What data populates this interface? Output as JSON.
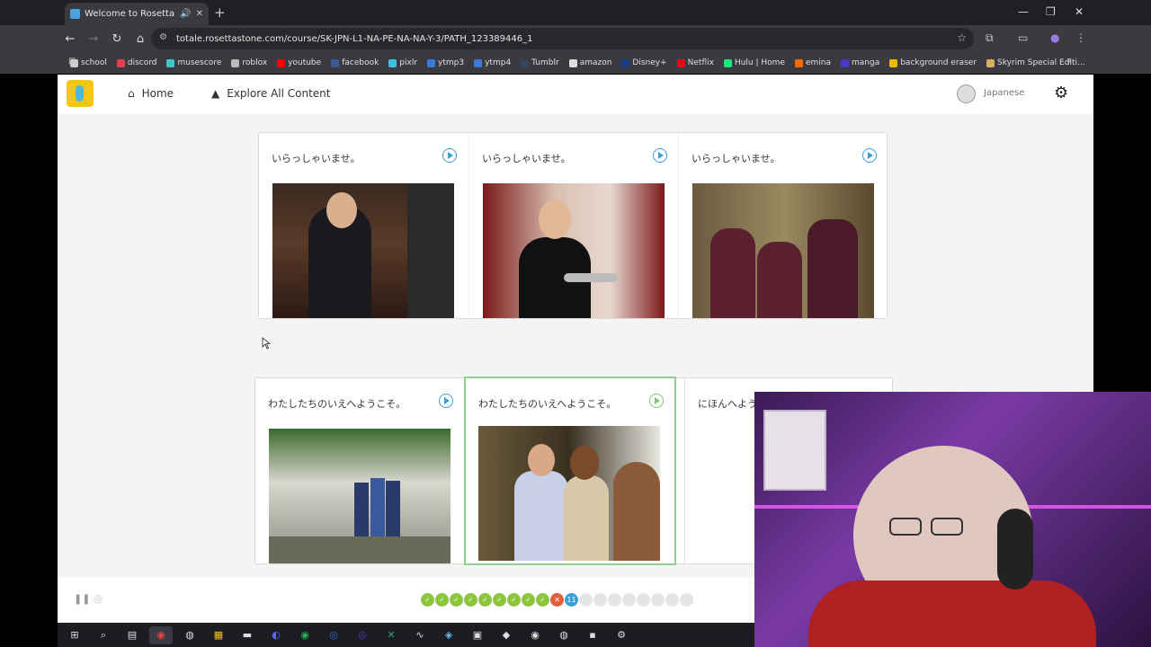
{
  "browser": {
    "tab_title": "Welcome to Rosetta Stone!",
    "tab_audio_icon": "speaker-icon",
    "url": "totale.rosettastone.com/course/SK-JPN-L1-NA-PE-NA-NA-Y-3/PATH_123389446_1",
    "bookmarks": [
      {
        "label": "school",
        "color": "#cccccc"
      },
      {
        "label": "discord",
        "color": "#e04050"
      },
      {
        "label": "musescore",
        "color": "#3ec9c9"
      },
      {
        "label": "roblox",
        "color": "#bbbbbb"
      },
      {
        "label": "youtube",
        "color": "#ff0000"
      },
      {
        "label": "facebook",
        "color": "#3b5998"
      },
      {
        "label": "pixlr",
        "color": "#40c0e0"
      },
      {
        "label": "ytmp3",
        "color": "#3a7ad9"
      },
      {
        "label": "ytmp4",
        "color": "#3a7ad9"
      },
      {
        "label": "Tumblr",
        "color": "#35465c"
      },
      {
        "label": "amazon",
        "color": "#dddddd"
      },
      {
        "label": "Disney+",
        "color": "#1a3a8a"
      },
      {
        "label": "Netflix",
        "color": "#e50914"
      },
      {
        "label": "Hulu | Home",
        "color": "#1ce783"
      },
      {
        "label": "emina",
        "color": "#ff6a00"
      },
      {
        "label": "manga",
        "color": "#4a3ac9"
      },
      {
        "label": "background eraser",
        "color": "#f5b800"
      },
      {
        "label": "Skyrim Special Editi...",
        "color": "#d9b060"
      }
    ]
  },
  "app": {
    "nav": {
      "home": "Home",
      "explore": "Explore All Content"
    },
    "language": "Japanese"
  },
  "cards_top": [
    {
      "text": "いらっしゃいませ。"
    },
    {
      "text": "いらっしゃいませ。"
    },
    {
      "text": "いらっしゃいませ。"
    }
  ],
  "cards_bottom": [
    {
      "text": "わたしたちのいえへようこそ。"
    },
    {
      "text": "わたしたちのいえへようこそ。"
    },
    {
      "text": "にほんへよう"
    }
  ],
  "progress": {
    "completed": 9,
    "wrong_index": 10,
    "current_label": "11",
    "remaining": 8
  },
  "taskbar_icons": [
    "windows-icon",
    "search-icon",
    "taskview-icon",
    "chrome-icon",
    "paint-icon",
    "files-icon",
    "explorer-icon",
    "discord-icon",
    "spotify-icon",
    "musescore-icon",
    "musescore4-icon",
    "excel-icon",
    "live-icon",
    "steam-icon",
    "photos-icon",
    "app-icon",
    "obs-icon",
    "browser-icon",
    "app2-icon",
    "settings-icon"
  ]
}
